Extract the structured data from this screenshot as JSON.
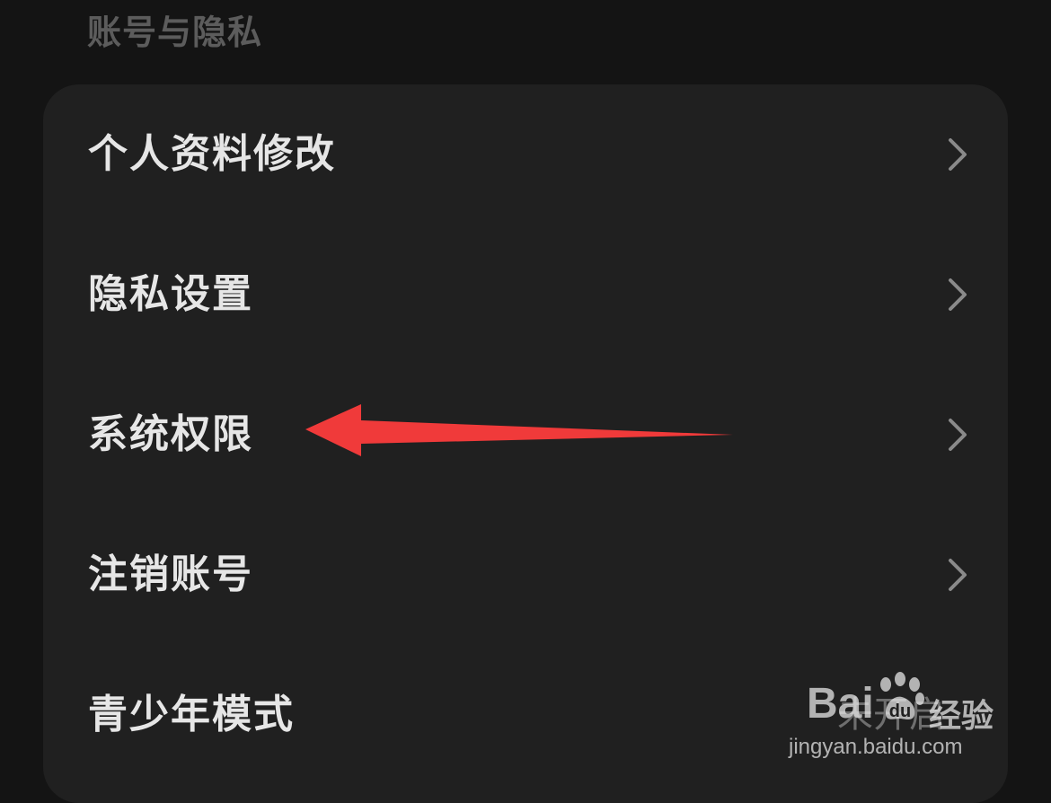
{
  "section": {
    "title": "账号与隐私"
  },
  "items": [
    {
      "label": "个人资料修改"
    },
    {
      "label": "隐私设置"
    },
    {
      "label": "系统权限"
    },
    {
      "label": "注销账号"
    },
    {
      "label": "青少年模式",
      "value": "未开启"
    }
  ],
  "icons": {
    "row_arrow": "chevron-right-icon"
  },
  "annotation": {
    "type": "arrow",
    "color": "#f03a3a",
    "points_to": "系统权限"
  },
  "watermark": {
    "brand": "Bai",
    "label": "经验",
    "url": "jingyan.baidu.com"
  },
  "colors": {
    "background": "#141414",
    "card": "#202020",
    "text_primary": "#e6e6e6",
    "text_secondary": "#5c5c5c",
    "chevron": "#8a8a8a"
  }
}
